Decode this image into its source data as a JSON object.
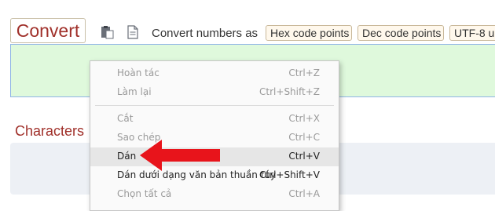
{
  "toolbar": {
    "convert_label": "Convert",
    "convert_numbers_label": "Convert numbers as",
    "hex_label": "Hex code points",
    "dec_label": "Dec code points",
    "utf8_label": "UTF-8 u"
  },
  "sections": {
    "characters_heading": "Characters"
  },
  "context_menu": {
    "items": [
      {
        "label": "Hoàn tác",
        "shortcut": "Ctrl+Z"
      },
      {
        "label": "Làm lại",
        "shortcut": "Ctrl+Shift+Z"
      },
      {
        "label": "Cắt",
        "shortcut": "Ctrl+X"
      },
      {
        "label": "Sao chép",
        "shortcut": "Ctrl+C"
      },
      {
        "label": "Dán",
        "shortcut": "Ctrl+V"
      },
      {
        "label": "Dán dưới dạng văn bản thuần túy",
        "shortcut": "Ctrl+Shift+V"
      },
      {
        "label": "Chọn tất cả",
        "shortcut": "Ctrl+A"
      }
    ]
  },
  "icons": {
    "paste": "clipboard-icon",
    "document": "document-icon",
    "annotation": "red-arrow-icon"
  },
  "colors": {
    "accent_red": "#a0302a",
    "input_bg": "#dff9dc",
    "arrow": "#e8141b"
  }
}
